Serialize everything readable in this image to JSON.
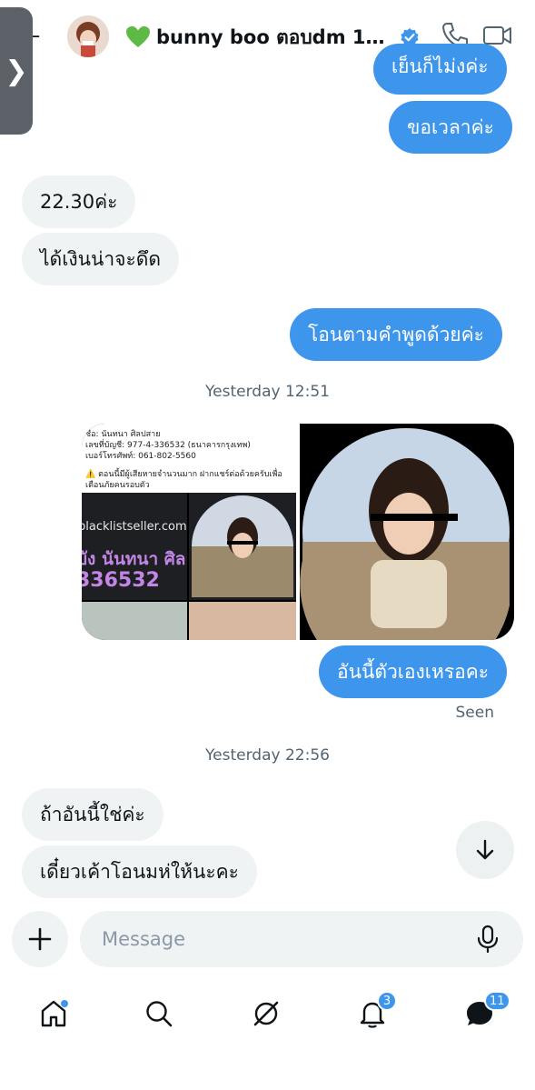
{
  "header": {
    "title": "bunny boo ตอบdm 17.0…",
    "heart_icon": "green-heart-icon",
    "verified_icon": "verified-badge-icon",
    "call_icon": "phone-icon",
    "video_icon": "video-camera-icon"
  },
  "messages": [
    {
      "side": "out",
      "text": "เย็นก็ไม่งค่ะ"
    },
    {
      "side": "out",
      "text": "ขอเวลาค่ะ"
    },
    {
      "side": "in",
      "text": "22.30ค่ะ"
    },
    {
      "side": "in",
      "text": "ได้เงินน่าจะดึด"
    },
    {
      "side": "out",
      "text": "โอนตามคำพูดด้วยค่ะ"
    },
    {
      "side": "out",
      "text": "อันนี้ตัวเองเหรอคะ"
    },
    {
      "side": "in",
      "text": "ถ้าอันนี้ใช่ค่ะ"
    },
    {
      "side": "in",
      "text": "เดี๋ยวเค้าโอนมห่ให้นะคะ"
    }
  ],
  "timestamps": [
    "Yesterday 12:51",
    "Yesterday 22:56"
  ],
  "seen_label": "Seen",
  "media": {
    "text_lines": [
      "ชื่อ: นันทนา ศิลปสาย",
      "เลขที่บัญชี: 977-4-336532 (ธนาคารกรุงเทพ)",
      "เบอร์โทรศัพท์: 061-802-5560",
      "⚠️ ตอนนี้มีผู้เสียหายจำนวนมาก ฝากแชร์ต่อด้วยครับเพื่อ",
      "เตือนภัยคนรอบตัว"
    ],
    "site": "blacklistseller.com",
    "name_big": "บัง นันทนา ศิล",
    "account_big": "336532"
  },
  "composer": {
    "placeholder": "Message"
  },
  "nav": {
    "home_icon": "home-icon",
    "search_icon": "search-icon",
    "grok_icon": "grok-icon",
    "notifications_badge": "3",
    "messages_badge": "11"
  },
  "colors": {
    "accent": "#3e96ec",
    "incoming": "#eff3f4",
    "muted": "#536471"
  }
}
